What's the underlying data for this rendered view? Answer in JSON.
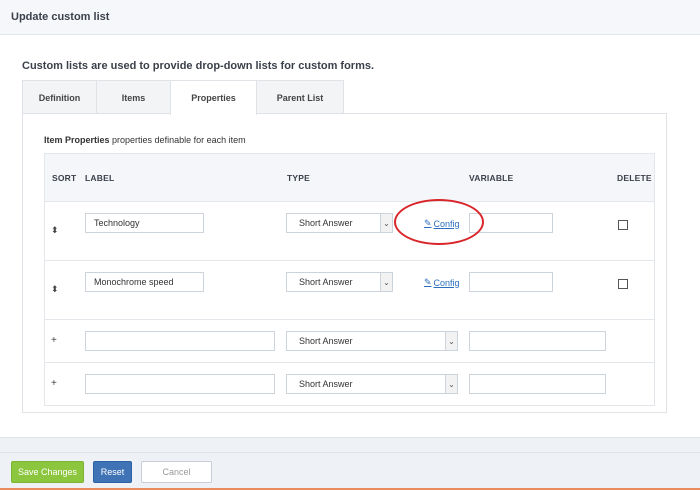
{
  "header": {
    "title": "Update custom list"
  },
  "subtitle": "Custom lists are used to provide drop-down lists for custom forms.",
  "tabs": [
    {
      "label": "Definition",
      "active": false
    },
    {
      "label": "Items",
      "active": false
    },
    {
      "label": "Properties",
      "active": true
    },
    {
      "label": "Parent List",
      "active": false
    }
  ],
  "item_properties": {
    "title": "Item Properties",
    "description": " properties definable for each item"
  },
  "table": {
    "columns": {
      "sort": "SORT",
      "label": "LABEL",
      "type": "TYPE",
      "variable": "VARIABLE",
      "delete": "DELETE"
    },
    "rows": [
      {
        "sort_icon": "⬍",
        "label": "Technology",
        "type": "Short Answer",
        "config": "Config",
        "variable": "",
        "delete_checked": false
      },
      {
        "sort_icon": "⬍",
        "label": "Monochrome speed",
        "type": "Short Answer",
        "config": "Config",
        "variable": "",
        "delete_checked": false
      }
    ],
    "new_rows": [
      {
        "plus": "+",
        "label": "",
        "type": "Short Answer",
        "variable": ""
      },
      {
        "plus": "+",
        "label": "",
        "type": "Short Answer",
        "variable": ""
      }
    ]
  },
  "footer": {
    "save": "Save Changes",
    "reset": "Reset",
    "cancel": "Cancel"
  },
  "colors": {
    "save": "#8cc63f",
    "reset": "#3f73b6",
    "link": "#2a6ebd",
    "highlight": "#d9262a"
  }
}
